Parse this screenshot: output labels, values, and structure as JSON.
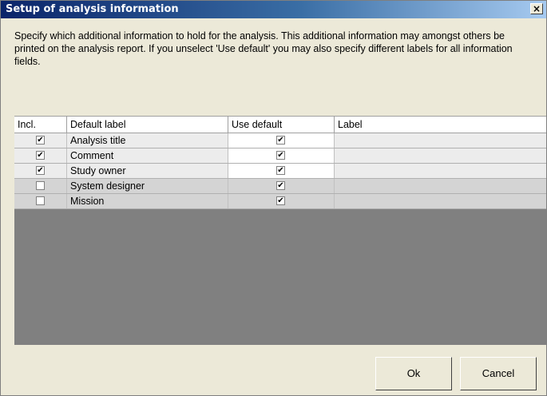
{
  "window": {
    "title": "Setup of analysis information",
    "close_glyph": "×"
  },
  "description": "Specify which additional information to hold for the analysis. This additional information may amongst others be printed on the analysis report. If you unselect 'Use default' you may also specify different labels for all information fields.",
  "table": {
    "columns": [
      "Incl.",
      "Default label",
      "Use default",
      "Label"
    ],
    "rows": [
      {
        "incl": true,
        "default_label": "Analysis title",
        "use_default": true,
        "label": ""
      },
      {
        "incl": true,
        "default_label": "Comment",
        "use_default": true,
        "label": ""
      },
      {
        "incl": true,
        "default_label": "Study owner",
        "use_default": true,
        "label": ""
      },
      {
        "incl": false,
        "default_label": "System designer",
        "use_default": true,
        "label": ""
      },
      {
        "incl": false,
        "default_label": "Mission",
        "use_default": true,
        "label": ""
      }
    ]
  },
  "buttons": {
    "ok": "Ok",
    "cancel": "Cancel"
  },
  "colors": {
    "title_bar_start": "#0a246a",
    "title_bar_end": "#a6caf0",
    "grid_background": "#808080"
  }
}
